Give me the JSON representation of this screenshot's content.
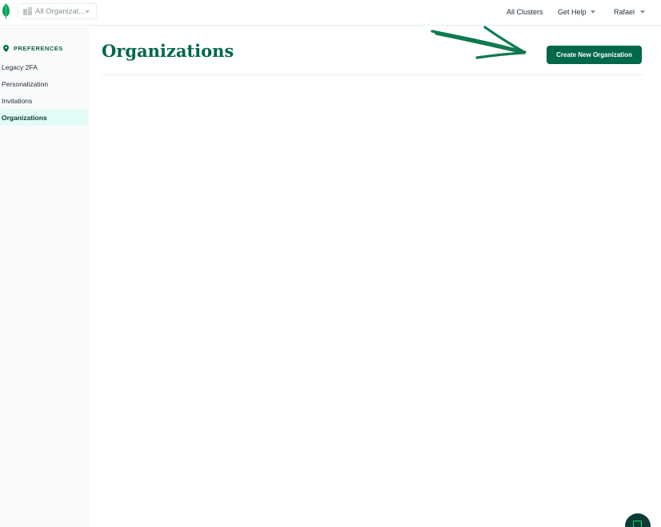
{
  "header": {
    "org_selector": "All Organizat...",
    "links": {
      "all_clusters": "All Clusters",
      "get_help": "Get Help",
      "user": "Rafael"
    }
  },
  "sidebar": {
    "section_title": "PREFERENCES",
    "items": [
      {
        "label": "Legacy 2FA",
        "active": false
      },
      {
        "label": "Personalization",
        "active": false
      },
      {
        "label": "Invitations",
        "active": false
      },
      {
        "label": "Organizations",
        "active": true
      }
    ]
  },
  "main": {
    "title": "Organizations",
    "create_button": "Create New Organization"
  },
  "colors": {
    "brand_green": "#00684a",
    "leaf_green": "#00a35c",
    "active_bg": "#e3fcf7",
    "annotation_arrow": "#0f7a4f"
  },
  "icons": [
    "mongodb-leaf-icon",
    "building-icon",
    "chevron-down-icon",
    "preferences-pin-icon",
    "help-chat-icon"
  ]
}
